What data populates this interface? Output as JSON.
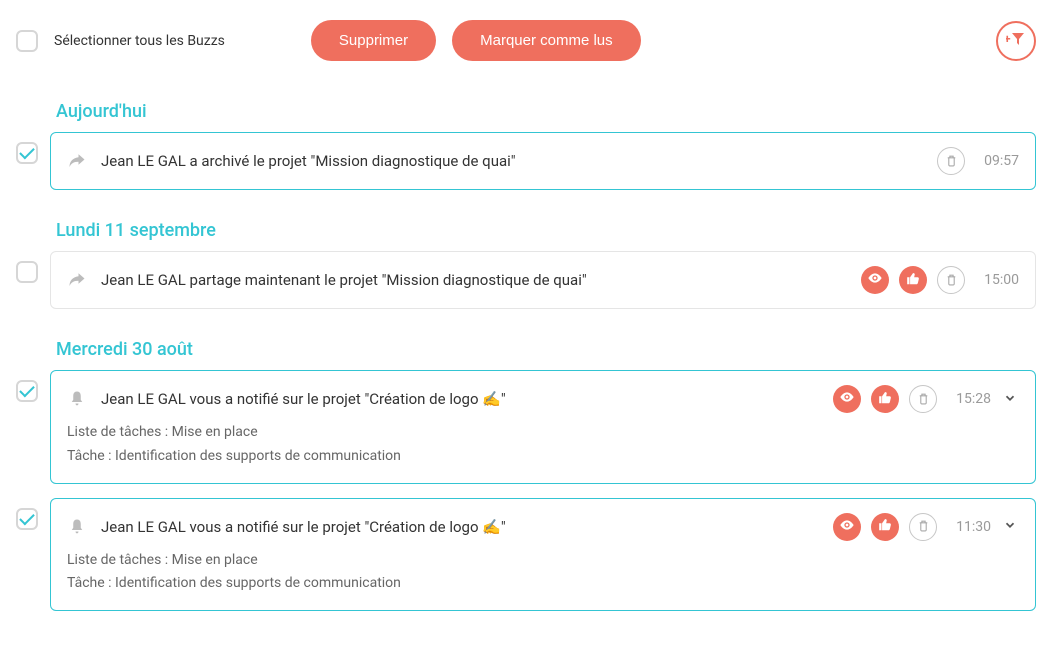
{
  "toolbar": {
    "select_all_label": "Sélectionner tous les Buzzs",
    "delete_label": "Supprimer",
    "mark_read_label": "Marquer comme lus"
  },
  "sections": [
    {
      "title": "Aujourd'hui",
      "items": [
        {
          "checked": true,
          "icon": "share",
          "title": "Jean LE GAL a archivé le projet \"Mission diagnostique de quai\"",
          "actions": {
            "eye": false,
            "like": false,
            "trash": true,
            "chevron": false
          },
          "time": "09:57",
          "body_lines": []
        }
      ]
    },
    {
      "title": "Lundi 11 septembre",
      "items": [
        {
          "checked": false,
          "icon": "share",
          "title": "Jean LE GAL partage maintenant le projet \"Mission diagnostique de quai\"",
          "actions": {
            "eye": true,
            "like": true,
            "trash": true,
            "chevron": false
          },
          "time": "15:00",
          "body_lines": []
        }
      ]
    },
    {
      "title": "Mercredi 30 août",
      "items": [
        {
          "checked": true,
          "icon": "bell",
          "title": "Jean LE GAL vous a notifié sur le projet \"Création de logo ✍️\"",
          "actions": {
            "eye": true,
            "like": true,
            "trash": true,
            "chevron": true
          },
          "time": "15:28",
          "body_lines": [
            "Liste de tâches : Mise en place",
            "Tâche : Identification des supports de communication"
          ]
        },
        {
          "checked": true,
          "icon": "bell",
          "title": "Jean LE GAL vous a notifié sur le projet \"Création de logo ✍️\"",
          "actions": {
            "eye": true,
            "like": true,
            "trash": true,
            "chevron": true
          },
          "time": "11:30",
          "body_lines": [
            "Liste de tâches : Mise en place",
            "Tâche : Identification des supports de communication"
          ]
        }
      ]
    }
  ]
}
